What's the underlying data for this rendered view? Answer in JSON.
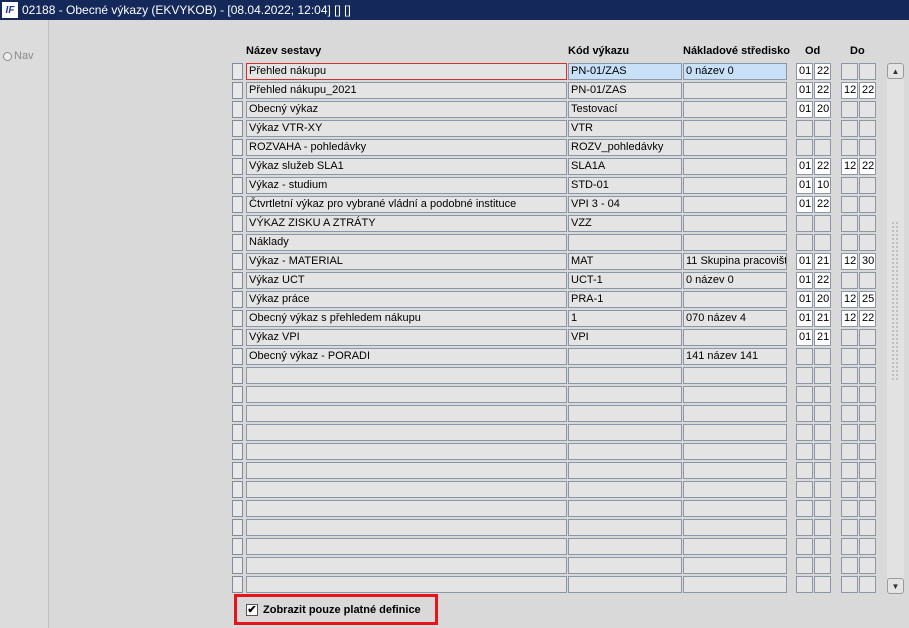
{
  "window": {
    "title": "02188 - Obecné výkazy (EKVYKOB) - [08.04.2022; 12:04] [] []",
    "icon_label": "IF"
  },
  "sidebar": {
    "nav_label": "Nav"
  },
  "columns": {
    "name": "Název sestavy",
    "code": "Kód výkazu",
    "center": "Nákladové středisko",
    "from": "Od",
    "to": "Do"
  },
  "rows": [
    {
      "name": "Přehled nákupu",
      "code": "PN-01/ZAS",
      "center": "0 název 0",
      "from_a": "01",
      "from_b": "22",
      "to_a": "",
      "to_b": ""
    },
    {
      "name": "Přehled nákupu_2021",
      "code": "PN-01/ZAS",
      "center": "",
      "from_a": "01",
      "from_b": "22",
      "to_a": "12",
      "to_b": "22"
    },
    {
      "name": "Obecný výkaz",
      "code": "Testovací",
      "center": "",
      "from_a": "01",
      "from_b": "20",
      "to_a": "",
      "to_b": ""
    },
    {
      "name": "Výkaz VTR-XY",
      "code": "VTR",
      "center": "",
      "from_a": "",
      "from_b": "",
      "to_a": "",
      "to_b": ""
    },
    {
      "name": "ROZVAHA - pohledávky",
      "code": "ROZV_pohledávky",
      "center": "",
      "from_a": "",
      "from_b": "",
      "to_a": "",
      "to_b": ""
    },
    {
      "name": "Výkaz služeb SLA1",
      "code": "SLA1A",
      "center": "",
      "from_a": "01",
      "from_b": "22",
      "to_a": "12",
      "to_b": "22"
    },
    {
      "name": "Výkaz - studium",
      "code": "STD-01",
      "center": "",
      "from_a": "01",
      "from_b": "10",
      "to_a": "",
      "to_b": ""
    },
    {
      "name": "Čtvrtletní výkaz pro vybrané vládní a podobné instituce",
      "code": "VPI 3 - 04",
      "center": "",
      "from_a": "01",
      "from_b": "22",
      "to_a": "",
      "to_b": ""
    },
    {
      "name": "VÝKAZ ZISKU A ZTRÁTY",
      "code": "VZZ",
      "center": "",
      "from_a": "",
      "from_b": "",
      "to_a": "",
      "to_b": ""
    },
    {
      "name": "Náklady",
      "code": "",
      "center": "",
      "from_a": "",
      "from_b": "",
      "to_a": "",
      "to_b": ""
    },
    {
      "name": "Výkaz - MATERIAL",
      "code": "MAT",
      "center": "11 Skupina pracovišť",
      "from_a": "01",
      "from_b": "21",
      "to_a": "12",
      "to_b": "30"
    },
    {
      "name": "Výkaz UCT",
      "code": "UCT-1",
      "center": "0 název 0",
      "from_a": "01",
      "from_b": "22",
      "to_a": "",
      "to_b": ""
    },
    {
      "name": "Výkaz práce",
      "code": "PRA-1",
      "center": "",
      "from_a": "01",
      "from_b": "20",
      "to_a": "12",
      "to_b": "25"
    },
    {
      "name": "Obecný výkaz s přehledem nákupu",
      "code": "1",
      "center": "070 název 4",
      "from_a": "01",
      "from_b": "21",
      "to_a": "12",
      "to_b": "22"
    },
    {
      "name": "Výkaz VPI",
      "code": "VPI",
      "center": "",
      "from_a": "01",
      "from_b": "21",
      "to_a": "",
      "to_b": ""
    },
    {
      "name": "Obecný výkaz - PORADI",
      "code": "",
      "center": "141 název 141",
      "from_a": "",
      "from_b": "",
      "to_a": "",
      "to_b": ""
    },
    {
      "name": "",
      "code": "",
      "center": "",
      "from_a": "",
      "from_b": "",
      "to_a": "",
      "to_b": ""
    },
    {
      "name": "",
      "code": "",
      "center": "",
      "from_a": "",
      "from_b": "",
      "to_a": "",
      "to_b": ""
    },
    {
      "name": "",
      "code": "",
      "center": "",
      "from_a": "",
      "from_b": "",
      "to_a": "",
      "to_b": ""
    },
    {
      "name": "",
      "code": "",
      "center": "",
      "from_a": "",
      "from_b": "",
      "to_a": "",
      "to_b": ""
    },
    {
      "name": "",
      "code": "",
      "center": "",
      "from_a": "",
      "from_b": "",
      "to_a": "",
      "to_b": ""
    },
    {
      "name": "",
      "code": "",
      "center": "",
      "from_a": "",
      "from_b": "",
      "to_a": "",
      "to_b": ""
    },
    {
      "name": "",
      "code": "",
      "center": "",
      "from_a": "",
      "from_b": "",
      "to_a": "",
      "to_b": ""
    },
    {
      "name": "",
      "code": "",
      "center": "",
      "from_a": "",
      "from_b": "",
      "to_a": "",
      "to_b": ""
    },
    {
      "name": "",
      "code": "",
      "center": "",
      "from_a": "",
      "from_b": "",
      "to_a": "",
      "to_b": ""
    },
    {
      "name": "",
      "code": "",
      "center": "",
      "from_a": "",
      "from_b": "",
      "to_a": "",
      "to_b": ""
    },
    {
      "name": "",
      "code": "",
      "center": "",
      "from_a": "",
      "from_b": "",
      "to_a": "",
      "to_b": ""
    },
    {
      "name": "",
      "code": "",
      "center": "",
      "from_a": "",
      "from_b": "",
      "to_a": "",
      "to_b": ""
    }
  ],
  "filter": {
    "checked": true,
    "label": "Zobrazit pouze platné definice"
  },
  "colors": {
    "titlebar": "#14285a",
    "highlight_border": "#e8141a",
    "selected_cell": "#c8e0f8"
  }
}
